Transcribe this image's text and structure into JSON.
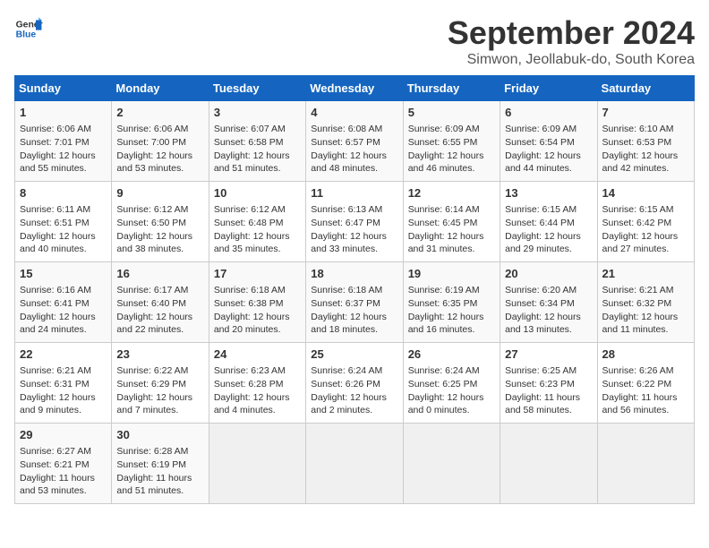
{
  "header": {
    "logo_line1": "General",
    "logo_line2": "Blue",
    "title": "September 2024",
    "subtitle": "Simwon, Jeollabuk-do, South Korea"
  },
  "days_of_week": [
    "Sunday",
    "Monday",
    "Tuesday",
    "Wednesday",
    "Thursday",
    "Friday",
    "Saturday"
  ],
  "weeks": [
    [
      {
        "day": "1",
        "sunrise": "6:06 AM",
        "sunset": "7:01 PM",
        "daylight": "12 hours and 55 minutes."
      },
      {
        "day": "2",
        "sunrise": "6:06 AM",
        "sunset": "7:00 PM",
        "daylight": "12 hours and 53 minutes."
      },
      {
        "day": "3",
        "sunrise": "6:07 AM",
        "sunset": "6:58 PM",
        "daylight": "12 hours and 51 minutes."
      },
      {
        "day": "4",
        "sunrise": "6:08 AM",
        "sunset": "6:57 PM",
        "daylight": "12 hours and 48 minutes."
      },
      {
        "day": "5",
        "sunrise": "6:09 AM",
        "sunset": "6:55 PM",
        "daylight": "12 hours and 46 minutes."
      },
      {
        "day": "6",
        "sunrise": "6:09 AM",
        "sunset": "6:54 PM",
        "daylight": "12 hours and 44 minutes."
      },
      {
        "day": "7",
        "sunrise": "6:10 AM",
        "sunset": "6:53 PM",
        "daylight": "12 hours and 42 minutes."
      }
    ],
    [
      {
        "day": "8",
        "sunrise": "6:11 AM",
        "sunset": "6:51 PM",
        "daylight": "12 hours and 40 minutes."
      },
      {
        "day": "9",
        "sunrise": "6:12 AM",
        "sunset": "6:50 PM",
        "daylight": "12 hours and 38 minutes."
      },
      {
        "day": "10",
        "sunrise": "6:12 AM",
        "sunset": "6:48 PM",
        "daylight": "12 hours and 35 minutes."
      },
      {
        "day": "11",
        "sunrise": "6:13 AM",
        "sunset": "6:47 PM",
        "daylight": "12 hours and 33 minutes."
      },
      {
        "day": "12",
        "sunrise": "6:14 AM",
        "sunset": "6:45 PM",
        "daylight": "12 hours and 31 minutes."
      },
      {
        "day": "13",
        "sunrise": "6:15 AM",
        "sunset": "6:44 PM",
        "daylight": "12 hours and 29 minutes."
      },
      {
        "day": "14",
        "sunrise": "6:15 AM",
        "sunset": "6:42 PM",
        "daylight": "12 hours and 27 minutes."
      }
    ],
    [
      {
        "day": "15",
        "sunrise": "6:16 AM",
        "sunset": "6:41 PM",
        "daylight": "12 hours and 24 minutes."
      },
      {
        "day": "16",
        "sunrise": "6:17 AM",
        "sunset": "6:40 PM",
        "daylight": "12 hours and 22 minutes."
      },
      {
        "day": "17",
        "sunrise": "6:18 AM",
        "sunset": "6:38 PM",
        "daylight": "12 hours and 20 minutes."
      },
      {
        "day": "18",
        "sunrise": "6:18 AM",
        "sunset": "6:37 PM",
        "daylight": "12 hours and 18 minutes."
      },
      {
        "day": "19",
        "sunrise": "6:19 AM",
        "sunset": "6:35 PM",
        "daylight": "12 hours and 16 minutes."
      },
      {
        "day": "20",
        "sunrise": "6:20 AM",
        "sunset": "6:34 PM",
        "daylight": "12 hours and 13 minutes."
      },
      {
        "day": "21",
        "sunrise": "6:21 AM",
        "sunset": "6:32 PM",
        "daylight": "12 hours and 11 minutes."
      }
    ],
    [
      {
        "day": "22",
        "sunrise": "6:21 AM",
        "sunset": "6:31 PM",
        "daylight": "12 hours and 9 minutes."
      },
      {
        "day": "23",
        "sunrise": "6:22 AM",
        "sunset": "6:29 PM",
        "daylight": "12 hours and 7 minutes."
      },
      {
        "day": "24",
        "sunrise": "6:23 AM",
        "sunset": "6:28 PM",
        "daylight": "12 hours and 4 minutes."
      },
      {
        "day": "25",
        "sunrise": "6:24 AM",
        "sunset": "6:26 PM",
        "daylight": "12 hours and 2 minutes."
      },
      {
        "day": "26",
        "sunrise": "6:24 AM",
        "sunset": "6:25 PM",
        "daylight": "12 hours and 0 minutes."
      },
      {
        "day": "27",
        "sunrise": "6:25 AM",
        "sunset": "6:23 PM",
        "daylight": "11 hours and 58 minutes."
      },
      {
        "day": "28",
        "sunrise": "6:26 AM",
        "sunset": "6:22 PM",
        "daylight": "11 hours and 56 minutes."
      }
    ],
    [
      {
        "day": "29",
        "sunrise": "6:27 AM",
        "sunset": "6:21 PM",
        "daylight": "11 hours and 53 minutes."
      },
      {
        "day": "30",
        "sunrise": "6:28 AM",
        "sunset": "6:19 PM",
        "daylight": "11 hours and 51 minutes."
      },
      null,
      null,
      null,
      null,
      null
    ]
  ]
}
